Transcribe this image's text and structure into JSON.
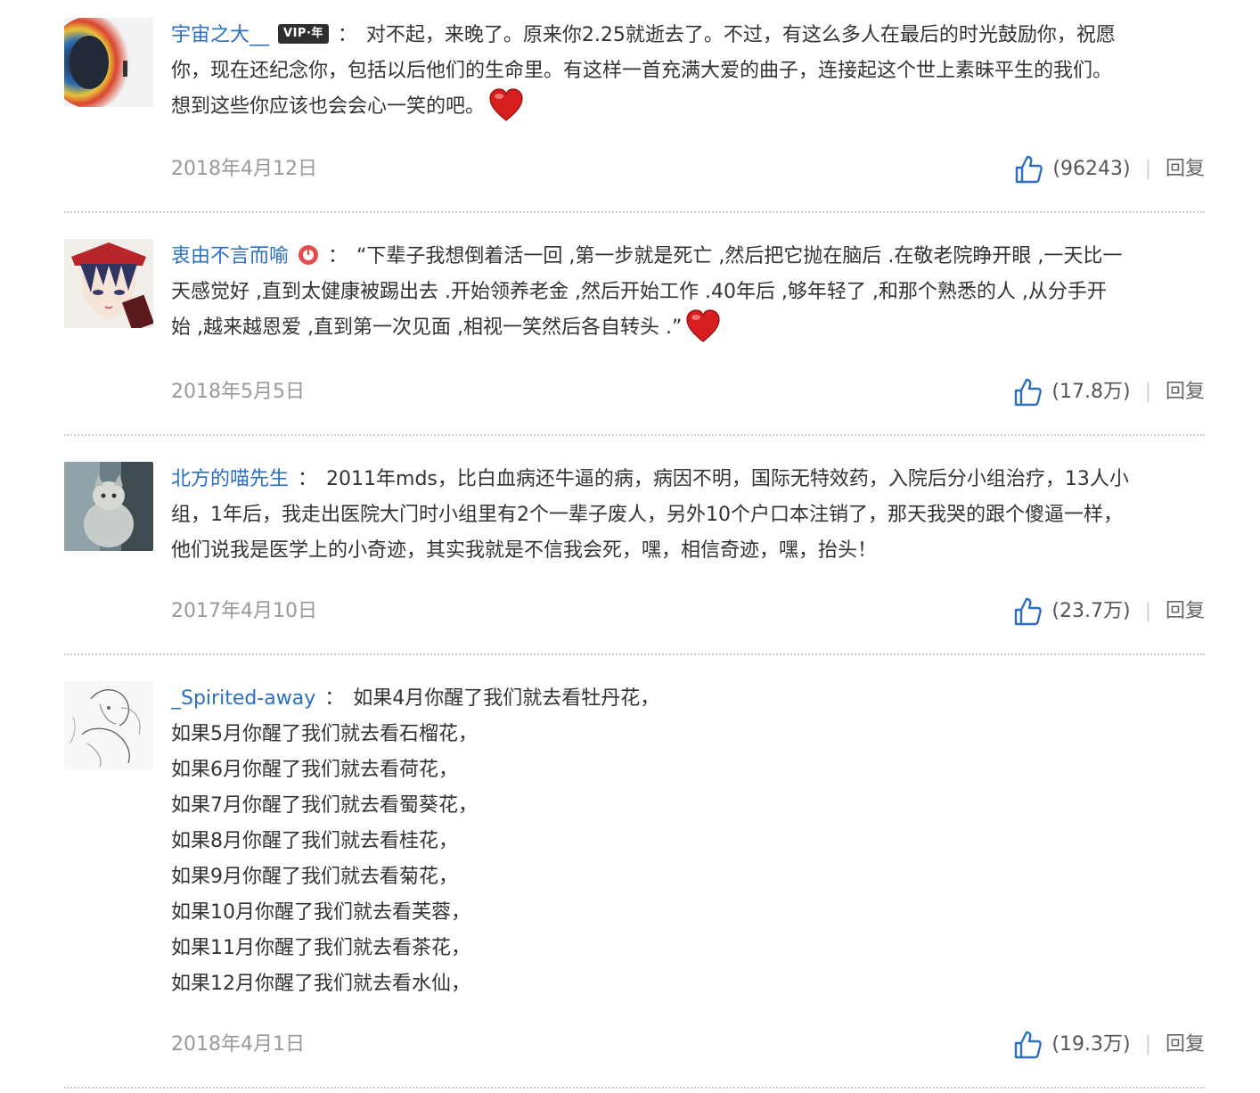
{
  "comments": [
    {
      "username": "宇宙之大__",
      "badge": "VIP·年",
      "colon": "：",
      "lines": [
        "对不起，来晚了。原来你2.25就逝去了。不过，有这么多人在最后的时光鼓励你，祝愿",
        "你，现在还纪念你，包括以后他们的生命里。有这样一首充满大爱的曲子，连接起这个世上素昧平生的我们。",
        "想到这些你应该也会会心一笑的吧。"
      ],
      "emoji": "heart-emoji",
      "date": "2018年4月12日",
      "likes": "(96243)",
      "reply": "回复"
    },
    {
      "username": "衷由不言而喻",
      "colon": "：",
      "lines": [
        "“下辈子我想倒着活一回 ,第一步就是死亡 ,然后把它抛在脑后 .在敬老院睁开眼 ,一天比一",
        "天感觉好 ,直到太健康被踢出去 .开始领养老金 ,然后开始工作 .40年后 ,够年轻了 ,和那个熟悉的人 ,从分手开",
        "始 ,越来越恩爱 ,直到第一次见面 ,相视一笑然后各自转头 .”"
      ],
      "emoji": "heart-emoji",
      "date": "2018年5月5日",
      "likes": "(17.8万)",
      "reply": "回复"
    },
    {
      "username": "北方的喵先生",
      "colon": "：",
      "lines": [
        "2011年mds，比白血病还牛逼的病，病因不明，国际无特效药，入院后分小组治疗，13人小",
        "组，1年后，我走出医院大门时小组里有2个一辈子废人，另外10个户口本注销了，那天我哭的跟个傻逼一样，",
        "他们说我是医学上的小奇迹，其实我就是不信我会死，嘿，相信奇迹，嘿，抬头！"
      ],
      "date": "2017年4月10日",
      "likes": "(23.7万)",
      "reply": "回复"
    },
    {
      "username": "_Spirited-away",
      "colon": "：",
      "lines": [
        "如果4月你醒了我们就去看牡丹花，",
        "如果5月你醒了我们就去看石榴花，",
        "如果6月你醒了我们就去看荷花，",
        "如果7月你醒了我们就去看蜀葵花，",
        "如果8月你醒了我们就去看桂花，",
        "如果9月你醒了我们就去看菊花，",
        "如果10月你醒了我们就去看芙蓉，",
        "如果11月你醒了我们就去看茶花，",
        "如果12月你醒了我们就去看水仙，"
      ],
      "date": "2018年4月1日",
      "likes": "(19.3万)",
      "reply": "回复"
    }
  ],
  "colors": {
    "username": "#2b6fc2",
    "meta": "#999999",
    "like_icon": "#2b6fc2",
    "heart": "#d81e1e"
  }
}
